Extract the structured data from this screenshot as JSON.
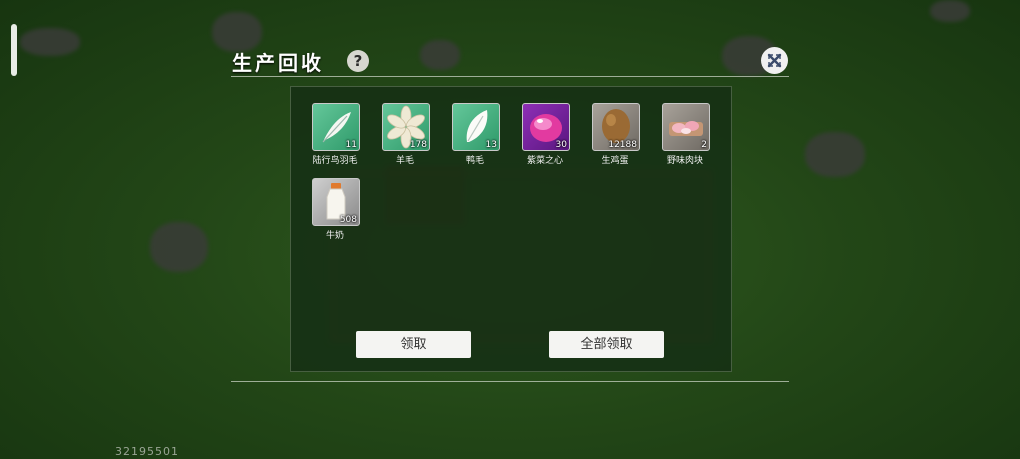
{
  "header": {
    "title": "生产回收",
    "help_glyph": "?"
  },
  "items": [
    {
      "name": "陆行鸟羽毛",
      "count": "11",
      "icon": "feather-icon"
    },
    {
      "name": "羊毛",
      "count": "178",
      "icon": "wool-icon"
    },
    {
      "name": "鸭毛",
      "count": "13",
      "icon": "duck-feather-icon"
    },
    {
      "name": "紫菜之心",
      "count": "30",
      "icon": "purple-gem-icon"
    },
    {
      "name": "生鸡蛋",
      "count": "12188",
      "icon": "egg-icon"
    },
    {
      "name": "野味肉块",
      "count": "2",
      "icon": "meat-icon"
    },
    {
      "name": "牛奶",
      "count": "508",
      "icon": "milk-bottle-icon"
    }
  ],
  "buttons": {
    "claim": "领取",
    "claim_all": "全部领取"
  },
  "footer": {
    "id": "32195501"
  }
}
